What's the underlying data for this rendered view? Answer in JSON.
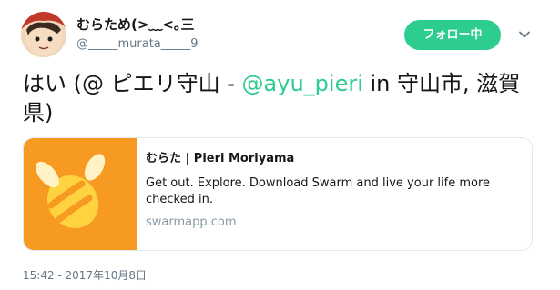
{
  "user": {
    "display_name": "むらため(>﹏<｡三",
    "handle": "@_____murata_____9"
  },
  "follow_label": "フォロー中",
  "tweet": {
    "part1": "はい (@ ピエリ守山 - ",
    "mention": "@ayu_pieri",
    "part2": " in 守山市, 滋賀県)"
  },
  "card": {
    "title": "むらた | Pieri Moriyama",
    "description": "Get out. Explore. Download Swarm and live your life more checked in.",
    "domain": "swarmapp.com",
    "image_bg": "#f79a21"
  },
  "timestamp": "15:42 - 2017年10月8日",
  "colors": {
    "accent": "#2dcc8f",
    "text": "#14171a",
    "muted": "#657786"
  }
}
